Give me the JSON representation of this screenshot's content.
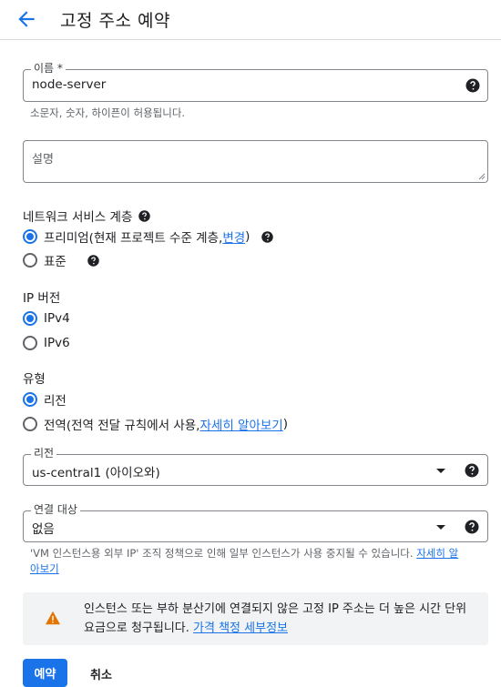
{
  "header": {
    "title": "고정 주소 예약"
  },
  "name": {
    "label": "이름 *",
    "value": "node-server",
    "hint": "소문자, 숫자, 하이픈이 허용됩니다."
  },
  "description": {
    "placeholder": "설명"
  },
  "tier": {
    "label": "네트워크 서비스 계층",
    "premium_prefix": "프리미엄(현재 프로젝트 수준 계층, ",
    "premium_link": "변경",
    "premium_suffix": ")",
    "standard": "표준"
  },
  "ip_version": {
    "label": "IP 버전",
    "v4": "IPv4",
    "v6": "IPv6"
  },
  "type": {
    "label": "유형",
    "regional": "리전",
    "global_prefix": "전역(전역 전달 규칙에서 사용, ",
    "global_link": "자세히 알아보기",
    "global_suffix": ")"
  },
  "region": {
    "label": "리전",
    "value": "us-central1 (아이오와)"
  },
  "attach": {
    "label": "연결 대상",
    "value": "없음"
  },
  "note": {
    "text": "'VM 인스턴스용 외부 IP' 조직 정책으로 인해 일부 인스턴스가 사용 중지될 수 있습니다. ",
    "link": "자세히 알아보기"
  },
  "warning": {
    "text": "인스턴스 또는 부하 분산기에 연결되지 않은 고정 IP 주소는 더 높은 시간 단위 요금으로 청구됩니다. ",
    "link": "가격 책정 세부정보"
  },
  "actions": {
    "reserve": "예약",
    "cancel": "취소"
  },
  "colors": {
    "accent": "#1a73e8",
    "warning": "#e37400"
  }
}
